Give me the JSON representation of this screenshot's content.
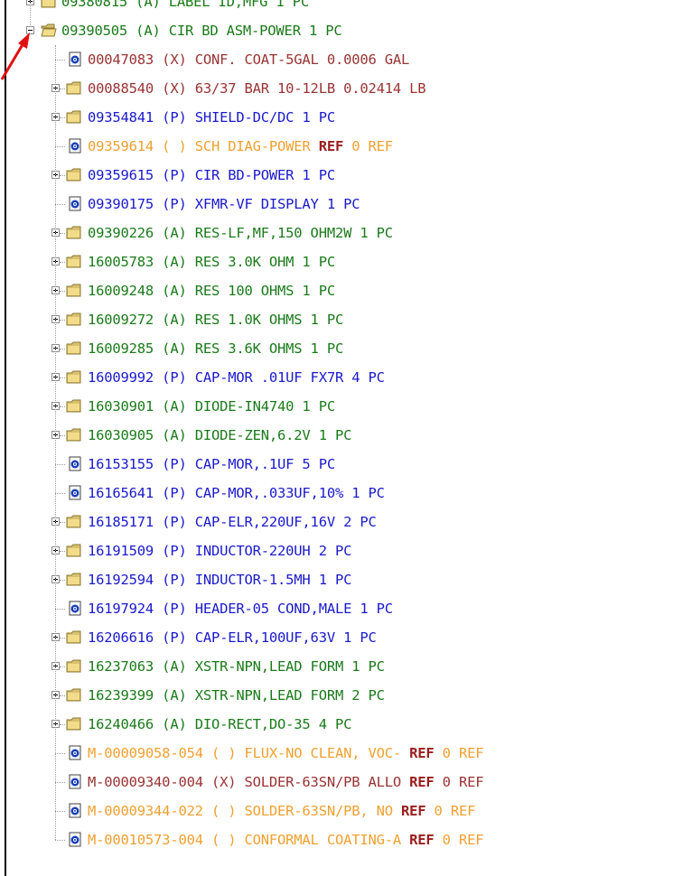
{
  "colors": {
    "assembly": "#1a7a1a",
    "purchased": "#1a1acc",
    "excluded": "#993333",
    "reference": "#f0a030",
    "ref_keyword": "#9a1d1d"
  },
  "tree": {
    "top_partial_label": "09380815 (A) LABEL ID,MFG 1 PC",
    "root": {
      "label": "09390505 (A) CIR BD ASM-POWER 1 PC"
    },
    "children": [
      {
        "pre": "00047083 (X) CONF. COAT-5GAL 0.0006 GAL",
        "ref": "",
        "post": "",
        "kind": "leaf",
        "type": "excluded"
      },
      {
        "pre": "00088540 (X) 63/37 BAR 10-12LB 0.02414 LB",
        "ref": "",
        "post": "",
        "kind": "folder",
        "type": "excluded"
      },
      {
        "pre": "09354841 (P) SHIELD-DC/DC 1 PC",
        "ref": "",
        "post": "",
        "kind": "folder",
        "type": "purchased"
      },
      {
        "pre": "09359614 ( ) SCH DIAG-POWER ",
        "ref": "REF",
        "post": " 0 REF",
        "kind": "leaf",
        "type": "reference"
      },
      {
        "pre": "09359615 (P) CIR BD-POWER 1 PC",
        "ref": "",
        "post": "",
        "kind": "folder",
        "type": "purchased"
      },
      {
        "pre": "09390175 (P) XFMR-VF DISPLAY 1 PC",
        "ref": "",
        "post": "",
        "kind": "leaf",
        "type": "purchased"
      },
      {
        "pre": "09390226 (A) RES-LF,MF,150 OHM2W 1 PC",
        "ref": "",
        "post": "",
        "kind": "folder",
        "type": "assembly"
      },
      {
        "pre": "16005783 (A) RES 3.0K OHM 1 PC",
        "ref": "",
        "post": "",
        "kind": "folder",
        "type": "assembly"
      },
      {
        "pre": "16009248 (A) RES 100 OHMS 1 PC",
        "ref": "",
        "post": "",
        "kind": "folder",
        "type": "assembly"
      },
      {
        "pre": "16009272 (A) RES 1.0K OHMS 1 PC",
        "ref": "",
        "post": "",
        "kind": "folder",
        "type": "assembly"
      },
      {
        "pre": "16009285 (A) RES 3.6K OHMS 1 PC",
        "ref": "",
        "post": "",
        "kind": "folder",
        "type": "assembly"
      },
      {
        "pre": "16009992 (P) CAP-MOR .01UF FX7R 4 PC",
        "ref": "",
        "post": "",
        "kind": "folder",
        "type": "purchased"
      },
      {
        "pre": "16030901 (A) DIODE-IN4740 1 PC",
        "ref": "",
        "post": "",
        "kind": "folder",
        "type": "assembly"
      },
      {
        "pre": "16030905 (A) DIODE-ZEN,6.2V 1 PC",
        "ref": "",
        "post": "",
        "kind": "folder",
        "type": "assembly"
      },
      {
        "pre": "16153155 (P) CAP-MOR,.1UF 5 PC",
        "ref": "",
        "post": "",
        "kind": "leaf",
        "type": "purchased"
      },
      {
        "pre": "16165641 (P) CAP-MOR,.033UF,10% 1 PC",
        "ref": "",
        "post": "",
        "kind": "leaf",
        "type": "purchased"
      },
      {
        "pre": "16185171 (P) CAP-ELR,220UF,16V 2 PC",
        "ref": "",
        "post": "",
        "kind": "folder",
        "type": "purchased"
      },
      {
        "pre": "16191509 (P) INDUCTOR-220UH 2 PC",
        "ref": "",
        "post": "",
        "kind": "folder",
        "type": "purchased"
      },
      {
        "pre": "16192594 (P) INDUCTOR-1.5MH 1 PC",
        "ref": "",
        "post": "",
        "kind": "folder",
        "type": "purchased"
      },
      {
        "pre": "16197924 (P) HEADER-05 COND,MALE 1 PC",
        "ref": "",
        "post": "",
        "kind": "leaf",
        "type": "purchased"
      },
      {
        "pre": "16206616 (P) CAP-ELR,100UF,63V 1 PC",
        "ref": "",
        "post": "",
        "kind": "folder",
        "type": "purchased"
      },
      {
        "pre": "16237063 (A) XSTR-NPN,LEAD FORM 1 PC",
        "ref": "",
        "post": "",
        "kind": "folder",
        "type": "assembly"
      },
      {
        "pre": "16239399 (A) XSTR-NPN,LEAD FORM 2 PC",
        "ref": "",
        "post": "",
        "kind": "folder",
        "type": "assembly"
      },
      {
        "pre": "16240466 (A) DIO-RECT,DO-35 4 PC",
        "ref": "",
        "post": "",
        "kind": "folder",
        "type": "assembly"
      },
      {
        "pre": "M-00009058-054 ( ) FLUX-NO CLEAN, VOC- ",
        "ref": "REF",
        "post": " 0 REF",
        "kind": "leaf",
        "type": "reference"
      },
      {
        "pre": "M-00009340-004 (X) SOLDER-63SN/PB ALLO ",
        "ref": "REF",
        "post": " 0 REF",
        "kind": "leaf",
        "type": "excluded"
      },
      {
        "pre": "M-00009344-022 ( ) SOLDER-63SN/PB, NO ",
        "ref": "REF",
        "post": " 0 REF",
        "kind": "leaf",
        "type": "reference"
      },
      {
        "pre": "M-00010573-004 ( ) CONFORMAL COATING-A ",
        "ref": "REF",
        "post": " 0 REF",
        "kind": "leaf",
        "type": "reference"
      }
    ]
  }
}
